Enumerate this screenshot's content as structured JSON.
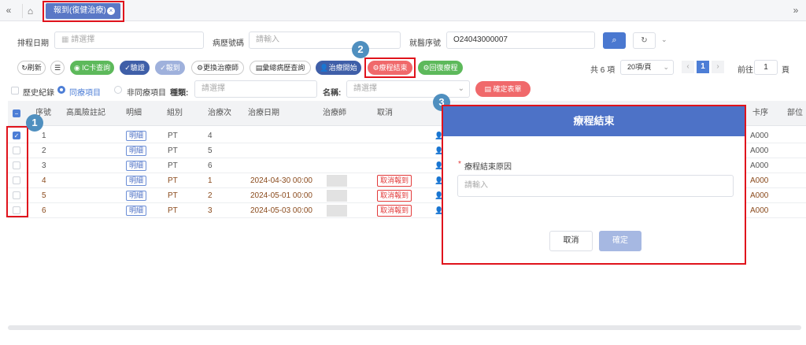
{
  "topbar": {
    "left_nav": "«",
    "right_nav": "»",
    "tab_label": "報到(復健治療)",
    "tab_close": "×"
  },
  "filters": {
    "schedule_date_label": "排程日期",
    "schedule_date_placeholder": "請選擇",
    "chart_no_label": "病歷號碼",
    "chart_no_placeholder": "請輸入",
    "visit_no_label": "就醫序號",
    "visit_no_value": "O24043000007"
  },
  "toolbar": {
    "refresh": "刷新",
    "ic_query": "IC卡查詢",
    "verify": "驗證",
    "checkin": "報到",
    "change_therapist": "更換治療師",
    "history_query": "彙總病歷查詢",
    "treat_start": "治療開始",
    "course_end": "療程結束",
    "restore_course": "回復療程",
    "total": "共 6 項",
    "page_size": "20項/頁",
    "current_page": "1",
    "goto_label": "前往",
    "goto_page": "1",
    "page_unit": "頁"
  },
  "options": {
    "history": "歷史紀錄",
    "same_item": "同療項目",
    "non_same_item": "非同療項目",
    "category_label": "種類:",
    "category_placeholder": "請選擇",
    "name_label": "名稱:",
    "name_placeholder": "請選擇",
    "confirm_form": "確定表單"
  },
  "table": {
    "headers": [
      "序號",
      "高風險註記",
      "明細",
      "組別",
      "治療次",
      "治療日期",
      "治療師",
      "取消",
      "卡序",
      "部位"
    ],
    "rows": [
      {
        "no": "1",
        "detail": "明細",
        "group": "PT",
        "times": "4",
        "date": "",
        "cancel": "",
        "card": "A000",
        "checked": true
      },
      {
        "no": "2",
        "detail": "明細",
        "group": "PT",
        "times": "5",
        "date": "",
        "cancel": "",
        "card": "A000",
        "checked": false
      },
      {
        "no": "3",
        "detail": "明細",
        "group": "PT",
        "times": "6",
        "date": "",
        "cancel": "",
        "card": "A000",
        "checked": false
      },
      {
        "no": "4",
        "detail": "明細",
        "group": "PT",
        "times": "1",
        "date": "2024-04-30 00:00",
        "cancel": "取消報到",
        "card": "A000",
        "checked": false
      },
      {
        "no": "5",
        "detail": "明細",
        "group": "PT",
        "times": "2",
        "date": "2024-05-01 00:00",
        "cancel": "取消報到",
        "card": "A000",
        "checked": false
      },
      {
        "no": "6",
        "detail": "明細",
        "group": "PT",
        "times": "3",
        "date": "2024-05-03 00:00",
        "cancel": "取消報到",
        "card": "A000",
        "checked": false
      }
    ]
  },
  "modal": {
    "title": "療程結束",
    "required_mark": "*",
    "reason_label": "療程結束原因",
    "reason_placeholder": "請輸入",
    "cancel": "取消",
    "confirm": "確定"
  },
  "callouts": [
    "1",
    "2",
    "3"
  ],
  "colors": {
    "primary": "#4d72c7",
    "highlight": "#e0131c",
    "success": "#5db95b",
    "danger": "#f0696b"
  }
}
